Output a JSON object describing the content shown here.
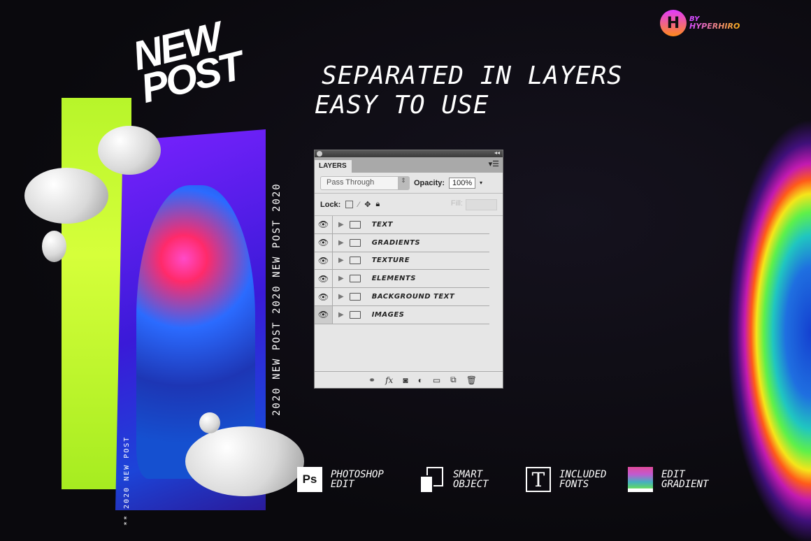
{
  "logo": {
    "mark": "H",
    "by": "BY",
    "name": "HYPERHIRO"
  },
  "headline": {
    "line1": "SEPARATED IN LAYERS",
    "line2": "EASY TO USE"
  },
  "poster": {
    "title_line1": "NEW",
    "title_line2": "POST",
    "vertical_text": "2020 NEW POST 2020 NEW POST 2020",
    "footer_text": "** 2020 NEW POST"
  },
  "layers_panel": {
    "tab": "LAYERS",
    "blend_mode": "Pass Through",
    "opacity_label": "Opacity:",
    "opacity_value": "100%",
    "lock_label": "Lock:",
    "fill_label": "Fill:",
    "layers": [
      {
        "name": "TEXT"
      },
      {
        "name": "GRADIENTS"
      },
      {
        "name": "TEXTURE"
      },
      {
        "name": "ELEMENTS"
      },
      {
        "name": "BACKGROUND TEXT"
      },
      {
        "name": "IMAGES"
      }
    ],
    "footer_icons": [
      "link-icon",
      "fx-icon",
      "mask-icon",
      "adjustment-icon",
      "new-group-icon",
      "new-layer-icon",
      "trash-icon"
    ]
  },
  "features": [
    {
      "icon": "photoshop-icon",
      "glyph": "Ps",
      "line1": "PHOTOSHOP",
      "line2": "EDIT"
    },
    {
      "icon": "smart-object-icon",
      "line1": "SMART",
      "line2": "OBJECT"
    },
    {
      "icon": "font-icon",
      "glyph": "T",
      "line1": "INCLUDED",
      "line2": "FONTS"
    },
    {
      "icon": "gradient-icon",
      "line1": "EDIT",
      "line2": "GRADIENT"
    }
  ]
}
